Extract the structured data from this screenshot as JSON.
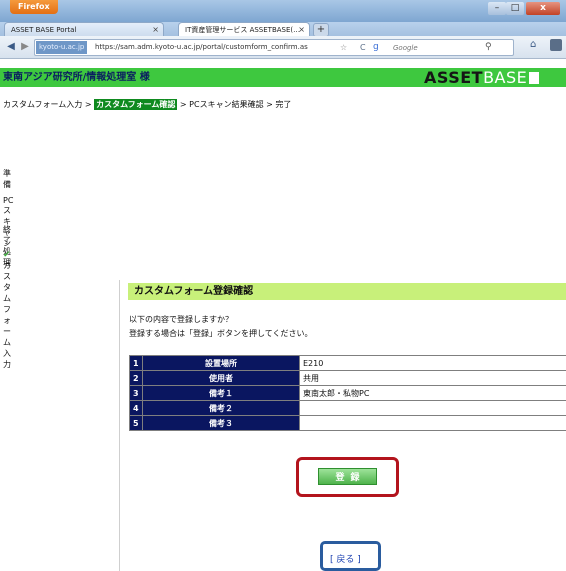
{
  "browser": {
    "app_button": "Firefox",
    "window_controls": {
      "minimize": "–",
      "maximize": "□",
      "close": "x"
    },
    "tabs": [
      {
        "label": "ASSET BASE Portal",
        "close": "×"
      },
      {
        "label": "IT資産管理サービス ASSETBASE(…",
        "close": "×"
      }
    ],
    "new_tab": "+",
    "back": "◀",
    "forward": "▶",
    "site_badge": "kyoto-u.ac.jp",
    "url": "https://sam.adm.kyoto-u.ac.jp/portal/customform_confirm.as",
    "search_placeholder": "Google",
    "star": "☆",
    "reload": "C",
    "search_icon": "⚲",
    "home_icon": "⌂"
  },
  "header": {
    "dept": "東南アジア研究所/情報処理室 様",
    "logo_asset": "ASSET",
    "logo_base": "BASE"
  },
  "breadcrumb": {
    "step1": "カスタムフォーム入力",
    "sep1": " > ",
    "current": "カスタムフォーム確認",
    "sep2": " > ",
    "step3": "PCスキャン結果確認",
    "sep3": " > ",
    "step4": "完了"
  },
  "steps": [
    {
      "label": "準備"
    },
    {
      "label": "PCスキャン"
    },
    {
      "label": "終了処理"
    },
    {
      "check": "✔",
      "label_line1": "カスタムフォーム",
      "label_line2": "入力"
    }
  ],
  "panel": {
    "title": "カスタムフォーム登録確認",
    "desc_line1": "以下の内容で登録しますか？",
    "desc_line2": "登録する場合は「登録」ボタンを押してください。"
  },
  "table": {
    "rows": [
      {
        "num": "1",
        "label": "設置場所",
        "value": "E210"
      },
      {
        "num": "2",
        "label": "使用者",
        "value": "共用"
      },
      {
        "num": "3",
        "label": "備考１",
        "value": "東南太郎・私物PC"
      },
      {
        "num": "4",
        "label": "備考２",
        "value": ""
      },
      {
        "num": "5",
        "label": "備考３",
        "value": ""
      }
    ]
  },
  "actions": {
    "register": "登録",
    "back": "[ 戻る ]"
  },
  "colors": {
    "header_green": "#3ec83f",
    "breadcrumb_current": "#0f8a1f",
    "panel_title_bg": "#c8f07a",
    "table_label_bg": "#0a1660",
    "register_highlight": "#b3141d",
    "back_highlight": "#2a5c9e"
  }
}
